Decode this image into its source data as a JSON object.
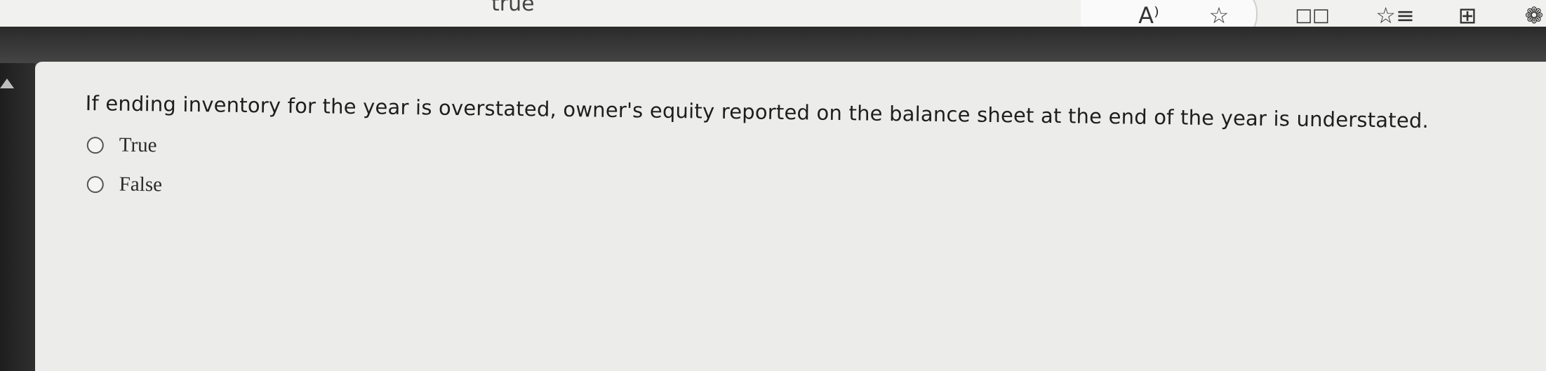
{
  "browser": {
    "address_fragment": "true",
    "icons": [
      "read-aloud-icon",
      "favorite-star-icon",
      "split-screen-icon",
      "favorites-list-icon",
      "collections-icon",
      "extensions-icon"
    ],
    "read_aloud_glyph": "A⁾",
    "star_glyph": "☆",
    "split_glyph": "□□",
    "favorites_glyph": "☆≡",
    "collections_glyph": "⊞",
    "extension_glyph": "❁"
  },
  "quiz": {
    "question": "If ending inventory for the year is overstated, owner's equity reported on the balance sheet at the end of the year is understated.",
    "options": [
      {
        "label": "True",
        "selected": false
      },
      {
        "label": "False",
        "selected": false
      }
    ]
  }
}
